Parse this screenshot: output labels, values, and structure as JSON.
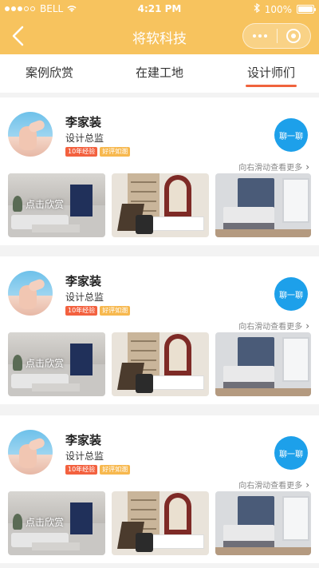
{
  "status": {
    "carrier": "BELL",
    "time": "4:21 PM",
    "battery": "100%",
    "battery_level": 1.0
  },
  "nav": {
    "title": "将软科技"
  },
  "tabs": [
    {
      "label": "案例欣赏",
      "active": false
    },
    {
      "label": "在建工地",
      "active": false
    },
    {
      "label": "设计师们",
      "active": true
    }
  ],
  "colors": {
    "accent": "#f7c35e",
    "tab_underline": "#f0633d",
    "chat": "#1da0ea",
    "badge_exp": "#f3613f",
    "badge_praise": "#f7b84e"
  },
  "designers": [
    {
      "name": "李家装",
      "role": "设计总监",
      "badges": [
        "10年经验",
        "好评如潮"
      ],
      "chat_label": "聊一聊",
      "swipe_hint": "向右滑动查看更多",
      "overlay": "点击欣赏"
    },
    {
      "name": "李家装",
      "role": "设计总监",
      "badges": [
        "10年经验",
        "好评如潮"
      ],
      "chat_label": "聊一聊",
      "swipe_hint": "向右滑动查看更多",
      "overlay": "点击欣赏"
    },
    {
      "name": "李家装",
      "role": "设计总监",
      "badges": [
        "10年经验",
        "好评如潮"
      ],
      "chat_label": "聊一聊",
      "swipe_hint": "向右滑动查看更多",
      "overlay": "点击欣赏"
    }
  ]
}
